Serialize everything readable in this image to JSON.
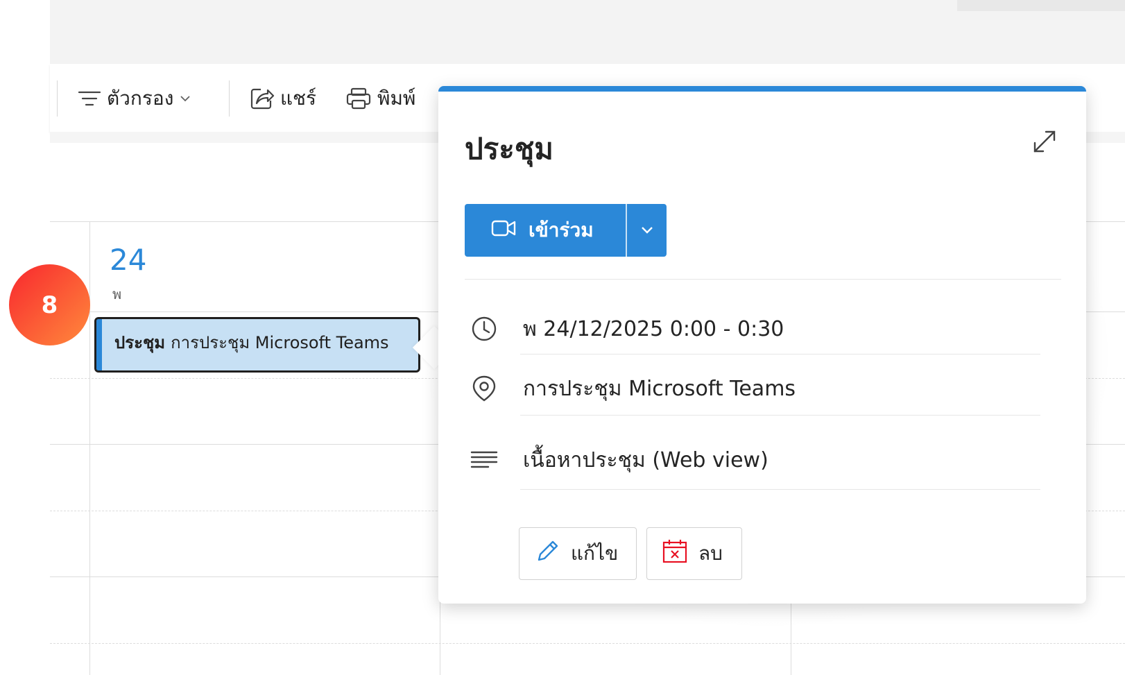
{
  "toolbar": {
    "filter_label": "ตัวกรอง",
    "share_label": "แชร์",
    "print_label": "พิมพ์"
  },
  "calendar": {
    "day_number": "24",
    "day_abbr": "พ",
    "event": {
      "title": "ประชุม",
      "location": "การประชุม Microsoft Teams"
    }
  },
  "badge": {
    "step": "8"
  },
  "popup": {
    "title": "ประชุม",
    "join_label": "เข้าร่วม",
    "datetime": "พ 24/12/2025 0:00 - 0:30",
    "location": "การประชุม Microsoft Teams",
    "content": "เนื้อหาประชุม (Web view)",
    "edit_label": "แก้ไข",
    "delete_label": "ลบ"
  },
  "colors": {
    "accent": "#2b88d8",
    "event_bg": "#c7e0f4",
    "badge_start": "#f8272e",
    "badge_end": "#ff8a3c",
    "delete_icon": "#e81123"
  },
  "icons": [
    "filter-icon",
    "chevron-down-icon",
    "share-icon",
    "print-icon",
    "expand-icon",
    "video-camera-icon",
    "clock-icon",
    "location-pin-icon",
    "text-lines-icon",
    "pencil-icon",
    "calendar-delete-icon"
  ]
}
